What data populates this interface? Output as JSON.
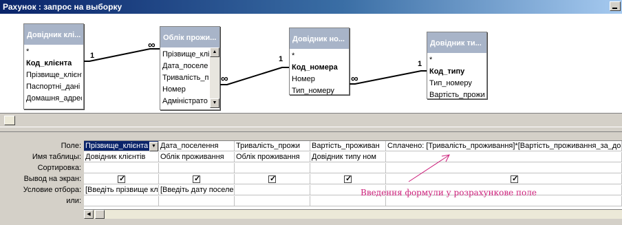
{
  "window": {
    "title": "Рахунок : запрос на выборку"
  },
  "tables": [
    {
      "title": "Довідник клі...",
      "fields": [
        "*",
        "Код_клієнта",
        "Прізвище_клієнт",
        "Паспортні_дані",
        "Домашня_адрес"
      ],
      "key_index": 1
    },
    {
      "title": "Облік прожи...",
      "fields": [
        "Прізвище_клі",
        "Дата_поселе",
        "Тривалість_п",
        "Номер",
        "Адміністрато"
      ],
      "key_index": -1
    },
    {
      "title": "Довідник но...",
      "fields": [
        "*",
        "Код_номера",
        "Номер",
        "Тип_номеру"
      ],
      "key_index": 1
    },
    {
      "title": "Довідник ти...",
      "fields": [
        "*",
        "Код_типу",
        "Тип_номеру",
        "Вартість_прожи"
      ],
      "key_index": 1
    }
  ],
  "relations": [
    {
      "one": "1",
      "many": "∞"
    },
    {
      "one": "1",
      "many": "∞"
    },
    {
      "one": "1",
      "many": "∞"
    }
  ],
  "grid": {
    "row_labels": [
      "Поле:",
      "Имя таблицы:",
      "Сортировка:",
      "Вывод на экран:",
      "Условие отбора:",
      "или:"
    ],
    "columns": [
      {
        "field": "Прізвище_клієнта",
        "table": "Довідник клієнтів",
        "sort": "",
        "show": true,
        "criteria": "[Введіть прізвище клієнта]",
        "or": ""
      },
      {
        "field": "Дата_поселення",
        "table": "Облік проживання",
        "sort": "",
        "show": true,
        "criteria": "[Введіть дату поселення]",
        "or": ""
      },
      {
        "field": "Тривалість_прожи",
        "table": "Облік проживання",
        "sort": "",
        "show": true,
        "criteria": "",
        "or": ""
      },
      {
        "field": "Вартість_проживан",
        "table": "Довідник типу ном",
        "sort": "",
        "show": true,
        "criteria": "",
        "or": ""
      },
      {
        "field": "Сплачено: [Тривалість_проживання]*[Вартість_проживання_за_добу]",
        "table": "",
        "sort": "",
        "show": true,
        "criteria": "",
        "or": ""
      }
    ],
    "annotation": "Введення формули у розрахункове поле",
    "annotation_color": "#cc1f7a"
  }
}
